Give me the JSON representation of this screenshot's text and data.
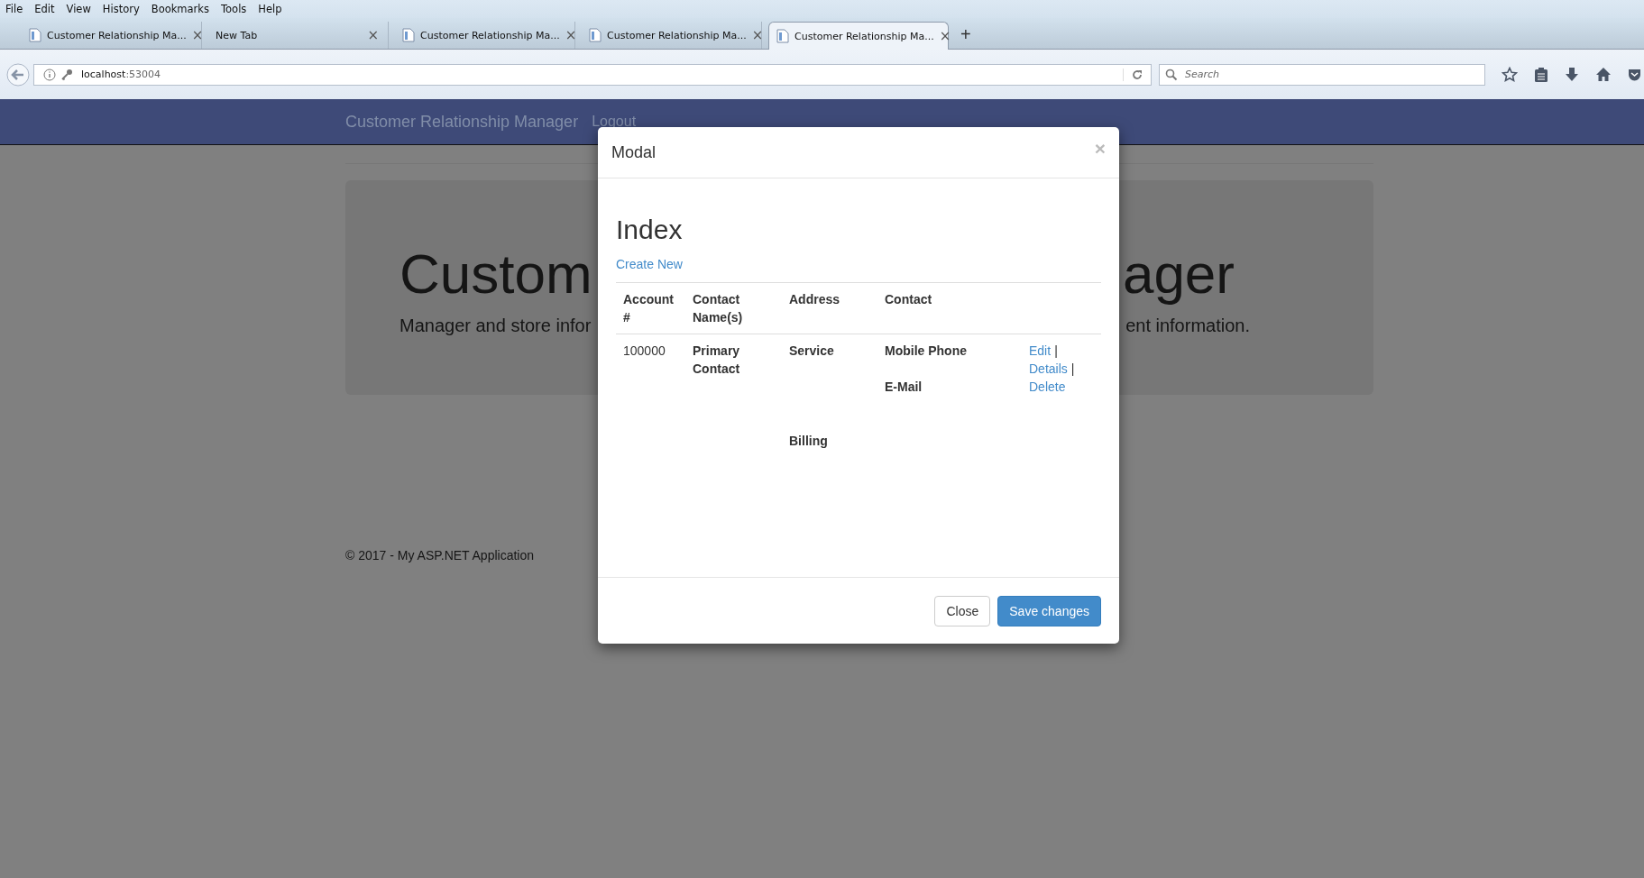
{
  "menu_bar": [
    "File",
    "Edit",
    "View",
    "History",
    "Bookmarks",
    "Tools",
    "Help"
  ],
  "tabs": [
    {
      "label": "Customer Relationship Ma...",
      "selected": false,
      "icon": true,
      "close": "×"
    },
    {
      "label": "New Tab",
      "selected": false,
      "icon": false,
      "close": "×"
    },
    {
      "label": "Customer Relationship Ma...",
      "selected": false,
      "icon": true,
      "close": "×"
    },
    {
      "label": "Customer Relationship Ma...",
      "selected": false,
      "icon": true,
      "close": "×"
    },
    {
      "label": "Customer Relationship Ma...",
      "selected": true,
      "icon": true,
      "close": "×"
    }
  ],
  "new_tab": "+",
  "address_bar": {
    "host": "localhost",
    "port": ":53004"
  },
  "search": {
    "placeholder": "Search"
  },
  "navbar": {
    "brand": "Customer Relationship Manager",
    "links": [
      "Logout"
    ]
  },
  "jumbotron": {
    "heading_left": "Custom",
    "heading_right": "ager",
    "lead_left": "Manager and store infor",
    "lead_right": "ent information."
  },
  "footer": "© 2017 - My ASP.NET Application",
  "modal": {
    "title": "Modal",
    "close": "×",
    "heading": "Index",
    "create_link": "Create New",
    "columns": [
      "Account #",
      "Contact Name(s)",
      "Address",
      "Contact"
    ],
    "rows": [
      {
        "account": "100000",
        "contact_name": "Primary Contact",
        "address": [
          "Service",
          "Billing"
        ],
        "contact": [
          "Mobile Phone",
          "E-Mail"
        ],
        "actions": [
          {
            "label": "Edit",
            "separator": "|"
          },
          {
            "label": "Details",
            "separator": "|"
          },
          {
            "label": "Delete"
          }
        ]
      }
    ],
    "buttons": [
      {
        "label": "Close",
        "kind": "default"
      },
      {
        "label": "Save changes",
        "kind": "primary"
      }
    ]
  }
}
